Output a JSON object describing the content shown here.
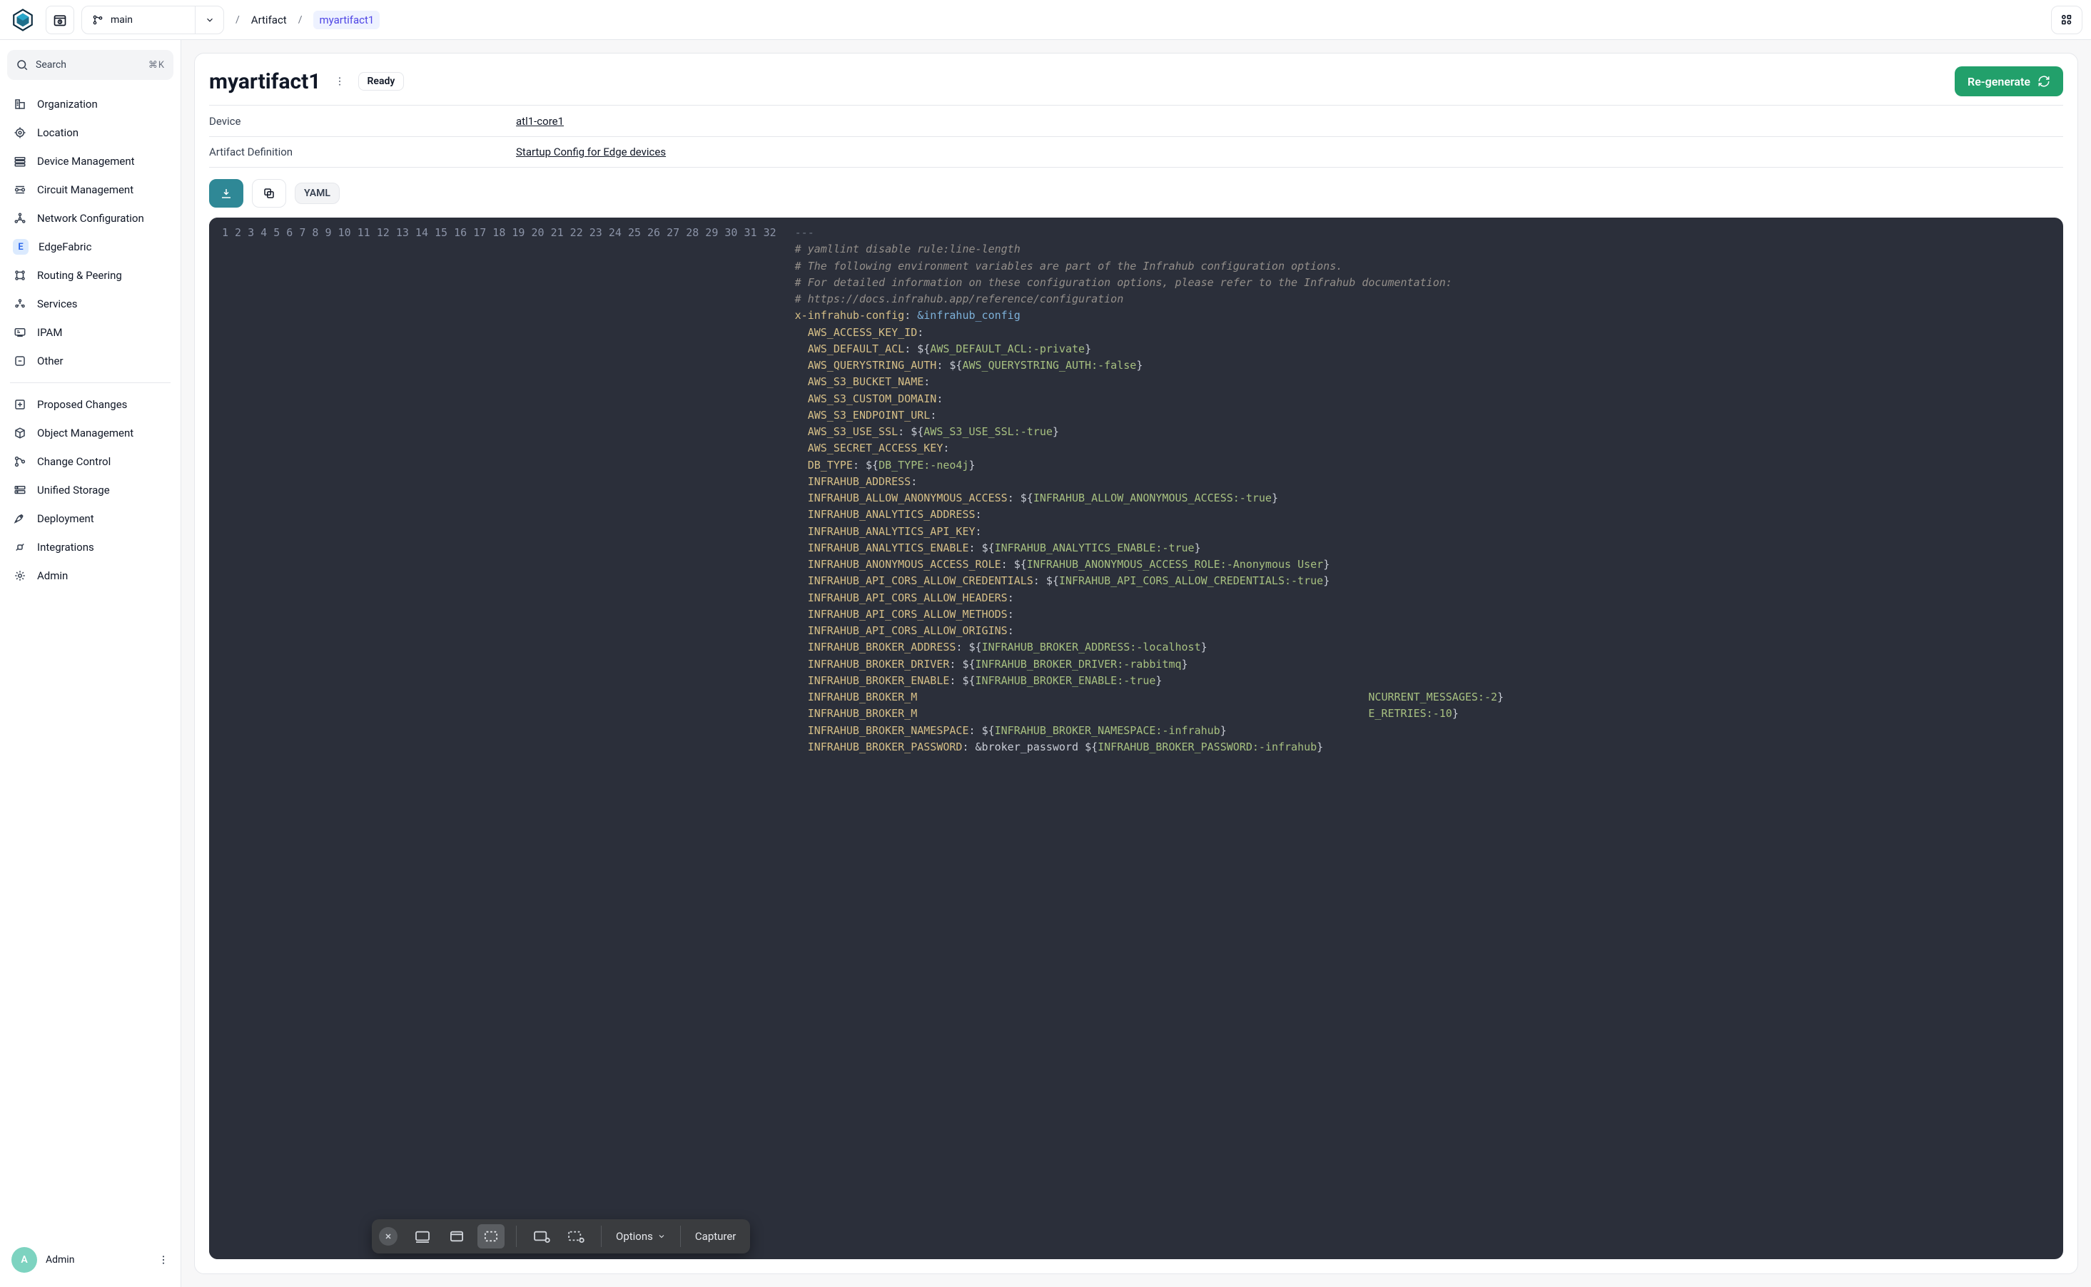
{
  "topbar": {
    "branch_name": "main",
    "breadcrumb": {
      "level1": "Artifact",
      "level2": "myartifact1"
    }
  },
  "search": {
    "placeholder": "Search",
    "shortcut": "⌘K"
  },
  "sidebar": {
    "groups": [
      {
        "items": [
          {
            "label": "Organization",
            "icon": "organization-icon"
          },
          {
            "label": "Location",
            "icon": "location-icon"
          },
          {
            "label": "Device Management",
            "icon": "device-icon"
          },
          {
            "label": "Circuit Management",
            "icon": "circuit-icon"
          },
          {
            "label": "Network Configuration",
            "icon": "network-icon"
          },
          {
            "label": "EdgeFabric",
            "icon": "badge-e"
          },
          {
            "label": "Routing & Peering",
            "icon": "routing-icon"
          },
          {
            "label": "Services",
            "icon": "services-icon"
          },
          {
            "label": "IPAM",
            "icon": "ipam-icon"
          },
          {
            "label": "Other",
            "icon": "other-icon"
          }
        ]
      },
      {
        "items": [
          {
            "label": "Proposed Changes",
            "icon": "proposed-icon"
          },
          {
            "label": "Object Management",
            "icon": "object-icon"
          },
          {
            "label": "Change Control",
            "icon": "change-icon"
          },
          {
            "label": "Unified Storage",
            "icon": "storage-icon"
          },
          {
            "label": "Deployment",
            "icon": "deployment-icon"
          },
          {
            "label": "Integrations",
            "icon": "integrations-icon"
          },
          {
            "label": "Admin",
            "icon": "admin-icon"
          }
        ]
      }
    ],
    "footer": {
      "initial": "A",
      "label": "Admin"
    }
  },
  "artifact": {
    "title": "myartifact1",
    "status": "Ready",
    "regenerate_label": "Re-generate",
    "meta": [
      {
        "key": "Device",
        "value": "atl1-core1"
      },
      {
        "key": "Artifact Definition",
        "value": "Startup Config for Edge devices"
      }
    ],
    "format_label": "YAML"
  },
  "code": {
    "lines": [
      {
        "n": 1,
        "kind": "dash",
        "raw": "---"
      },
      {
        "n": 2,
        "kind": "comment",
        "raw": "# yamllint disable rule:line-length"
      },
      {
        "n": 3,
        "kind": "comment",
        "raw": "# The following environment variables are part of the Infrahub configuration options."
      },
      {
        "n": 4,
        "kind": "comment",
        "raw": "# For detailed information on these configuration options, please refer to the Infrahub documentation:"
      },
      {
        "n": 5,
        "kind": "comment",
        "raw": "# https://docs.infrahub.app/reference/configuration"
      },
      {
        "n": 6,
        "kind": "anchor",
        "key": "x-infrahub-config",
        "anchor": "&infrahub_config"
      },
      {
        "n": 7,
        "kind": "kv",
        "indent": 1,
        "key": "AWS_ACCESS_KEY_ID",
        "value": ""
      },
      {
        "n": 8,
        "kind": "kv",
        "indent": 1,
        "key": "AWS_DEFAULT_ACL",
        "template": "AWS_DEFAULT_ACL:-private"
      },
      {
        "n": 9,
        "kind": "kv",
        "indent": 1,
        "key": "AWS_QUERYSTRING_AUTH",
        "template": "AWS_QUERYSTRING_AUTH:-false"
      },
      {
        "n": 10,
        "kind": "kv",
        "indent": 1,
        "key": "AWS_S3_BUCKET_NAME",
        "value": ""
      },
      {
        "n": 11,
        "kind": "kv",
        "indent": 1,
        "key": "AWS_S3_CUSTOM_DOMAIN",
        "value": ""
      },
      {
        "n": 12,
        "kind": "kv",
        "indent": 1,
        "key": "AWS_S3_ENDPOINT_URL",
        "value": ""
      },
      {
        "n": 13,
        "kind": "kv",
        "indent": 1,
        "key": "AWS_S3_USE_SSL",
        "template": "AWS_S3_USE_SSL:-true"
      },
      {
        "n": 14,
        "kind": "kv",
        "indent": 1,
        "key": "AWS_SECRET_ACCESS_KEY",
        "value": ""
      },
      {
        "n": 15,
        "kind": "kv",
        "indent": 1,
        "key": "DB_TYPE",
        "template": "DB_TYPE:-neo4j"
      },
      {
        "n": 16,
        "kind": "kv",
        "indent": 1,
        "key": "INFRAHUB_ADDRESS",
        "value": ""
      },
      {
        "n": 17,
        "kind": "kv",
        "indent": 1,
        "key": "INFRAHUB_ALLOW_ANONYMOUS_ACCESS",
        "template": "INFRAHUB_ALLOW_ANONYMOUS_ACCESS:-true"
      },
      {
        "n": 18,
        "kind": "kv",
        "indent": 1,
        "key": "INFRAHUB_ANALYTICS_ADDRESS",
        "value": ""
      },
      {
        "n": 19,
        "kind": "kv",
        "indent": 1,
        "key": "INFRAHUB_ANALYTICS_API_KEY",
        "value": ""
      },
      {
        "n": 20,
        "kind": "kv",
        "indent": 1,
        "key": "INFRAHUB_ANALYTICS_ENABLE",
        "template": "INFRAHUB_ANALYTICS_ENABLE:-true"
      },
      {
        "n": 21,
        "kind": "kv",
        "indent": 1,
        "key": "INFRAHUB_ANONYMOUS_ACCESS_ROLE",
        "template": "INFRAHUB_ANONYMOUS_ACCESS_ROLE:-Anonymous User"
      },
      {
        "n": 22,
        "kind": "kv",
        "indent": 1,
        "key": "INFRAHUB_API_CORS_ALLOW_CREDENTIALS",
        "template": "INFRAHUB_API_CORS_ALLOW_CREDENTIALS:-true"
      },
      {
        "n": 23,
        "kind": "kv",
        "indent": 1,
        "key": "INFRAHUB_API_CORS_ALLOW_HEADERS",
        "value": ""
      },
      {
        "n": 24,
        "kind": "kv",
        "indent": 1,
        "key": "INFRAHUB_API_CORS_ALLOW_METHODS",
        "value": ""
      },
      {
        "n": 25,
        "kind": "kv",
        "indent": 1,
        "key": "INFRAHUB_API_CORS_ALLOW_ORIGINS",
        "value": ""
      },
      {
        "n": 26,
        "kind": "kv",
        "indent": 1,
        "key": "INFRAHUB_BROKER_ADDRESS",
        "template": "INFRAHUB_BROKER_ADDRESS:-localhost"
      },
      {
        "n": 27,
        "kind": "kv",
        "indent": 1,
        "key": "INFRAHUB_BROKER_DRIVER",
        "template": "INFRAHUB_BROKER_DRIVER:-rabbitmq"
      },
      {
        "n": 28,
        "kind": "kv",
        "indent": 1,
        "key": "INFRAHUB_BROKER_ENABLE",
        "template": "INFRAHUB_BROKER_ENABLE:-true"
      },
      {
        "n": 29,
        "kind": "kv_trunc",
        "indent": 1,
        "key": "INFRAHUB_BROKER_M",
        "tail_template": "NCURRENT_MESSAGES:-2"
      },
      {
        "n": 30,
        "kind": "kv_trunc",
        "indent": 1,
        "key": "INFRAHUB_BROKER_M",
        "tail_template": "E_RETRIES:-10"
      },
      {
        "n": 31,
        "kind": "kv",
        "indent": 1,
        "key": "INFRAHUB_BROKER_NAMESPACE",
        "template": "INFRAHUB_BROKER_NAMESPACE:-infrahub"
      },
      {
        "n": 32,
        "kind": "kv_ref",
        "indent": 1,
        "key": "INFRAHUB_BROKER_PASSWORD",
        "ref": "&broker_password",
        "template": "INFRAHUB_BROKER_PASSWORD:-infrahub"
      }
    ]
  },
  "osbar": {
    "options_label": "Options",
    "capture_label": "Capturer"
  }
}
